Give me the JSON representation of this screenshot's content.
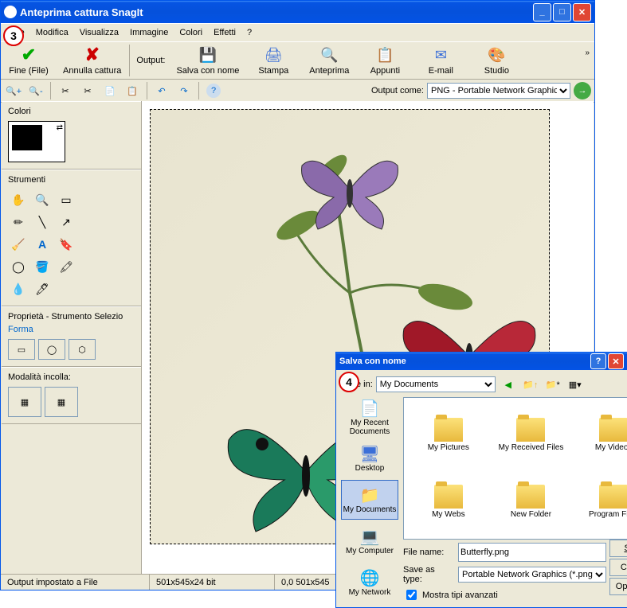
{
  "main_window": {
    "title": "Anteprima cattura SnagIt",
    "menu": {
      "file": "File",
      "modifica": "Modifica",
      "visualizza": "Visualizza",
      "immagine": "Immagine",
      "colori": "Colori",
      "effetti": "Effetti",
      "help": "?"
    },
    "toolbar1": {
      "fine": "Fine (File)",
      "annulla": "Annulla cattura",
      "output_label": "Output:",
      "salva": "Salva con nome",
      "stampa": "Stampa",
      "anteprima": "Anteprima",
      "appunti": "Appunti",
      "email": "E-mail",
      "studio": "Studio"
    },
    "toolbar2": {
      "output_come": "Output come:",
      "format": "PNG - Portable Network Graphics"
    },
    "sidebar": {
      "colori": "Colori",
      "strumenti": "Strumenti",
      "proprieta": "Proprietà - Strumento Selezio",
      "forma": "Forma",
      "modalita": "Modalità incolla:"
    },
    "status": {
      "left": "Output impostato a File",
      "mid": "501x545x24 bit",
      "right": "0,0  501x545"
    }
  },
  "annot3": "3",
  "annot4": "4",
  "save_dialog": {
    "title": "Salva con nome",
    "savein_label": "Save in:",
    "savein_value": "My Documents",
    "places": {
      "recent": "My Recent Documents",
      "desktop": "Desktop",
      "mydocs": "My Documents",
      "mycomp": "My Computer",
      "mynet": "My Network"
    },
    "folders": {
      "pictures": "My Pictures",
      "received": "My Received Files",
      "videos": "My Videos",
      "webs": "My Webs",
      "newfolder": "New Folder",
      "program": "Program Files"
    },
    "filename_label": "File name:",
    "filename": "Butterfly.png",
    "type_label": "Save as type:",
    "type": "Portable Network Graphics (*.png)",
    "show_advanced": "Mostra tipi avanzati",
    "buttons": {
      "save": "Save",
      "cancel": "Cancel",
      "options": "Opzioni..."
    }
  }
}
